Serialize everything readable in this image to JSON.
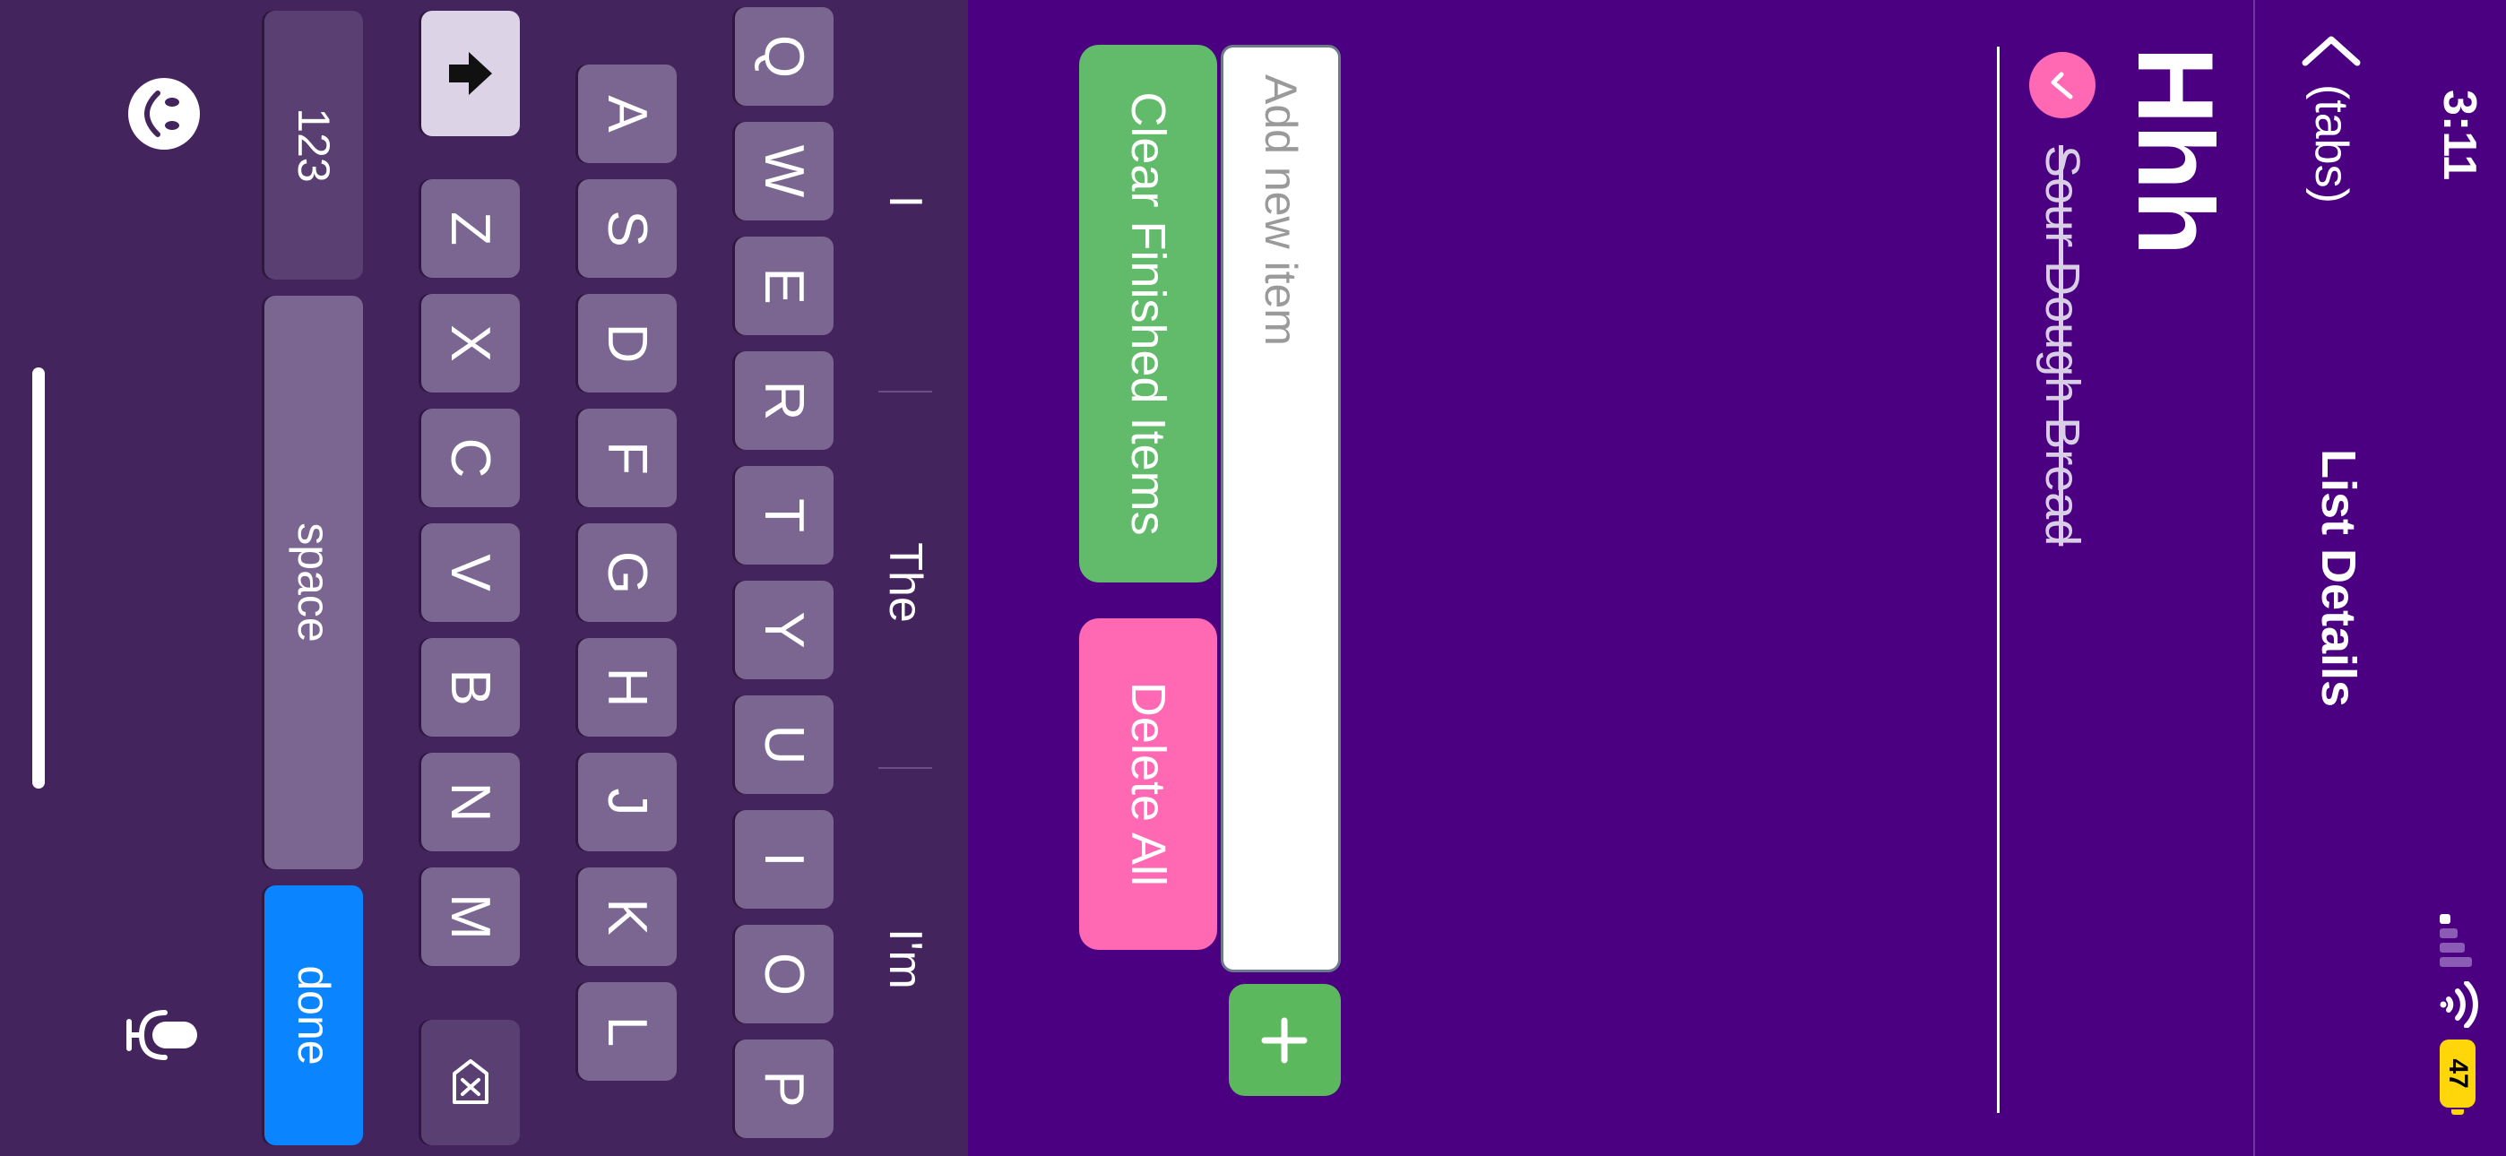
{
  "status_bar": {
    "time": "3:11",
    "battery": "47"
  },
  "nav": {
    "back_label": "(tabs)",
    "title": "List Details"
  },
  "list": {
    "title": "Hhh",
    "items": [
      {
        "label": "Sour Dough Bread",
        "done": true
      }
    ]
  },
  "add_item": {
    "placeholder": "Add new item",
    "value": "",
    "add_icon": "plus-icon"
  },
  "buttons": {
    "clear_finished": "Clear Finished Items",
    "delete_all": "Delete All"
  },
  "keyboard": {
    "suggestions": [
      "I",
      "The",
      "I'm"
    ],
    "row1": [
      "Q",
      "W",
      "E",
      "R",
      "T",
      "Y",
      "U",
      "I",
      "O",
      "P"
    ],
    "row2": [
      "A",
      "S",
      "D",
      "F",
      "G",
      "H",
      "J",
      "K",
      "L"
    ],
    "row3": [
      "Z",
      "X",
      "C",
      "V",
      "B",
      "N",
      "M"
    ],
    "numbers_label": "123",
    "space_label": "space",
    "done_label": "done"
  },
  "colors": {
    "background": "#4b0082",
    "accent_pink": "#ff69b4",
    "accent_green": "#62bb6a",
    "keyboard_bg": "#44245c",
    "done_blue": "#0a84ff"
  }
}
